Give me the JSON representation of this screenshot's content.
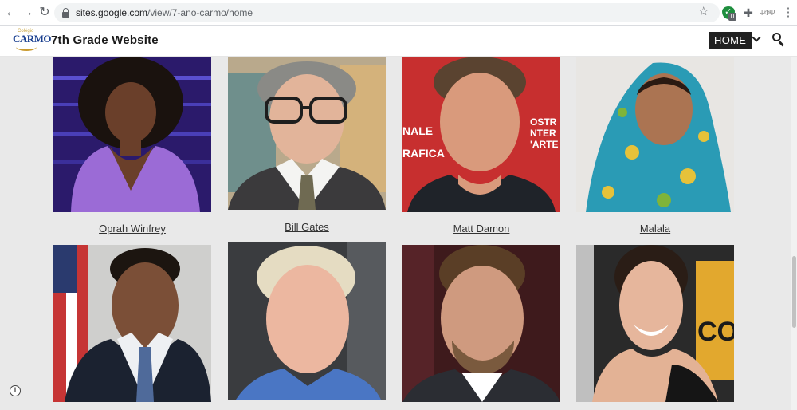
{
  "browser": {
    "url_host": "sites.google.com",
    "url_path": "/view/7-ano-carmo/home",
    "profile_label": "ΨΦΨ"
  },
  "site": {
    "logo_small": "Colégio",
    "logo_main": "CARMO",
    "title": "7th Grade Website",
    "nav_home": "HOME"
  },
  "people": [
    {
      "name": "Oprah Winfrey",
      "icon": "portrait-oprah"
    },
    {
      "name": "Bill Gates",
      "icon": "portrait-bill-gates"
    },
    {
      "name": "Matt Damon",
      "icon": "portrait-matt-damon"
    },
    {
      "name": "Malala",
      "icon": "portrait-malala"
    },
    {
      "name": "",
      "icon": "portrait-barack-obama"
    },
    {
      "name": "",
      "icon": "portrait-ellen-degeneres"
    },
    {
      "name": "",
      "icon": "portrait-leonardo-dicaprio"
    },
    {
      "name": "",
      "icon": "portrait-angelina-jolie"
    }
  ],
  "colors": {
    "page_bg": "#e9e9e9",
    "home_button_bg": "#212121",
    "home_button_fg": "#ffffff"
  }
}
